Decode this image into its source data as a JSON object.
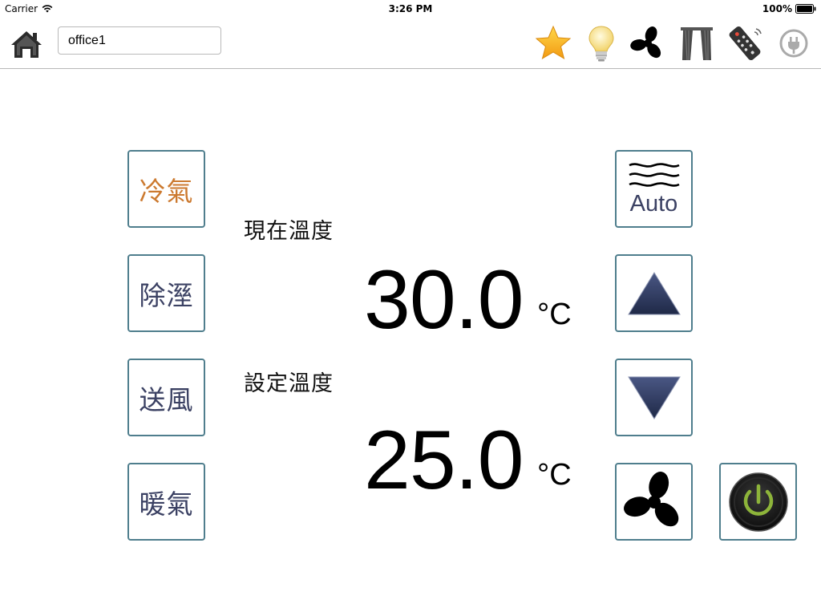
{
  "status_bar": {
    "carrier": "Carrier",
    "time": "3:26 PM",
    "battery": "100%"
  },
  "header": {
    "room_name": "office1",
    "icons": [
      "home-icon",
      "star-icon",
      "light-bulb-icon",
      "fan-icon",
      "curtain-icon",
      "remote-icon",
      "plug-icon"
    ]
  },
  "modes": [
    {
      "label": "冷氣",
      "active": true
    },
    {
      "label": "除溼",
      "active": false
    },
    {
      "label": "送風",
      "active": false
    },
    {
      "label": "暖氣",
      "active": false
    }
  ],
  "current_temp": {
    "label": "現在溫度",
    "value": "30.0",
    "unit": "°C"
  },
  "set_temp": {
    "label": "設定溫度",
    "value": "25.0",
    "unit": "°C"
  },
  "controls": {
    "fan_speed_label": "Auto"
  },
  "colors": {
    "button_border": "#4f7e8d",
    "active_mode_text": "#cc7a30",
    "mode_text": "#3b4163",
    "arrow_fill": "#2e3a5c",
    "power_ring": "#8db43a"
  }
}
